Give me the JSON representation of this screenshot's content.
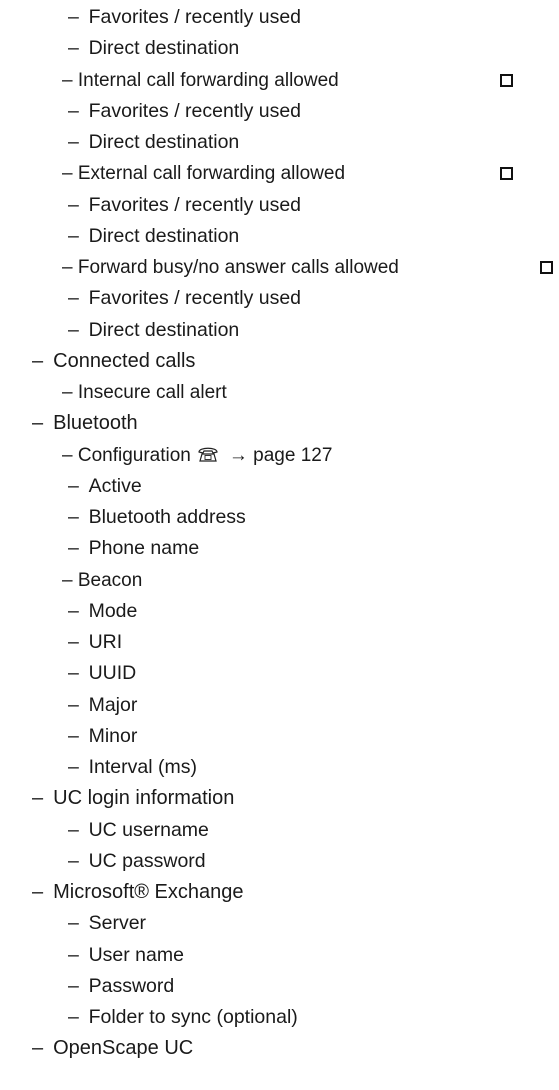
{
  "items": [
    {
      "level": 3,
      "text": "– Favorites / recently used"
    },
    {
      "level": 3,
      "text": "– Direct destination"
    },
    {
      "level": 2,
      "text": "– Internal call forwarding allowed",
      "checkbox": true
    },
    {
      "level": 3,
      "text": "– Favorites / recently used"
    },
    {
      "level": 3,
      "text": "– Direct destination"
    },
    {
      "level": 2,
      "text": "– External call forwarding allowed",
      "checkbox": true
    },
    {
      "level": 3,
      "text": "– Favorites / recently used"
    },
    {
      "level": 3,
      "text": "– Direct destination"
    },
    {
      "level": 2,
      "text": "– Forward busy/no answer calls allowed",
      "checkbox": true
    },
    {
      "level": 3,
      "text": "– Favorites / recently used"
    },
    {
      "level": 3,
      "text": "– Direct destination"
    },
    {
      "level": 1,
      "text": "– Connected calls"
    },
    {
      "level": 2,
      "text": "– Insecure call alert"
    },
    {
      "level": 1,
      "text": "– Bluetooth"
    },
    {
      "level": 2,
      "text": "– Configuration",
      "icon": "phone-icon",
      "suffix": "→ page 127"
    },
    {
      "level": 3,
      "text": "– Active"
    },
    {
      "level": 3,
      "text": "– Bluetooth address"
    },
    {
      "level": 3,
      "text": "– Phone name"
    },
    {
      "level": 2,
      "text": "– Beacon"
    },
    {
      "level": 3,
      "text": "– Mode"
    },
    {
      "level": 3,
      "text": "– URI"
    },
    {
      "level": 3,
      "text": "– UUID"
    },
    {
      "level": 3,
      "text": "– Major"
    },
    {
      "level": 3,
      "text": "– Minor"
    },
    {
      "level": 3,
      "text": "– Interval (ms)"
    },
    {
      "level": 1,
      "text": "– UC login information"
    },
    {
      "level": 3,
      "text": "– UC username"
    },
    {
      "level": 3,
      "text": "– UC password"
    },
    {
      "level": 1,
      "text": "– Microsoft® Exchange"
    },
    {
      "level": 3,
      "text": "– Server"
    },
    {
      "level": 3,
      "text": "– User name"
    },
    {
      "level": 3,
      "text": "– Password"
    },
    {
      "level": 3,
      "text": "– Folder to sync (optional)"
    },
    {
      "level": 1,
      "text": "– OpenScape UC"
    }
  ]
}
